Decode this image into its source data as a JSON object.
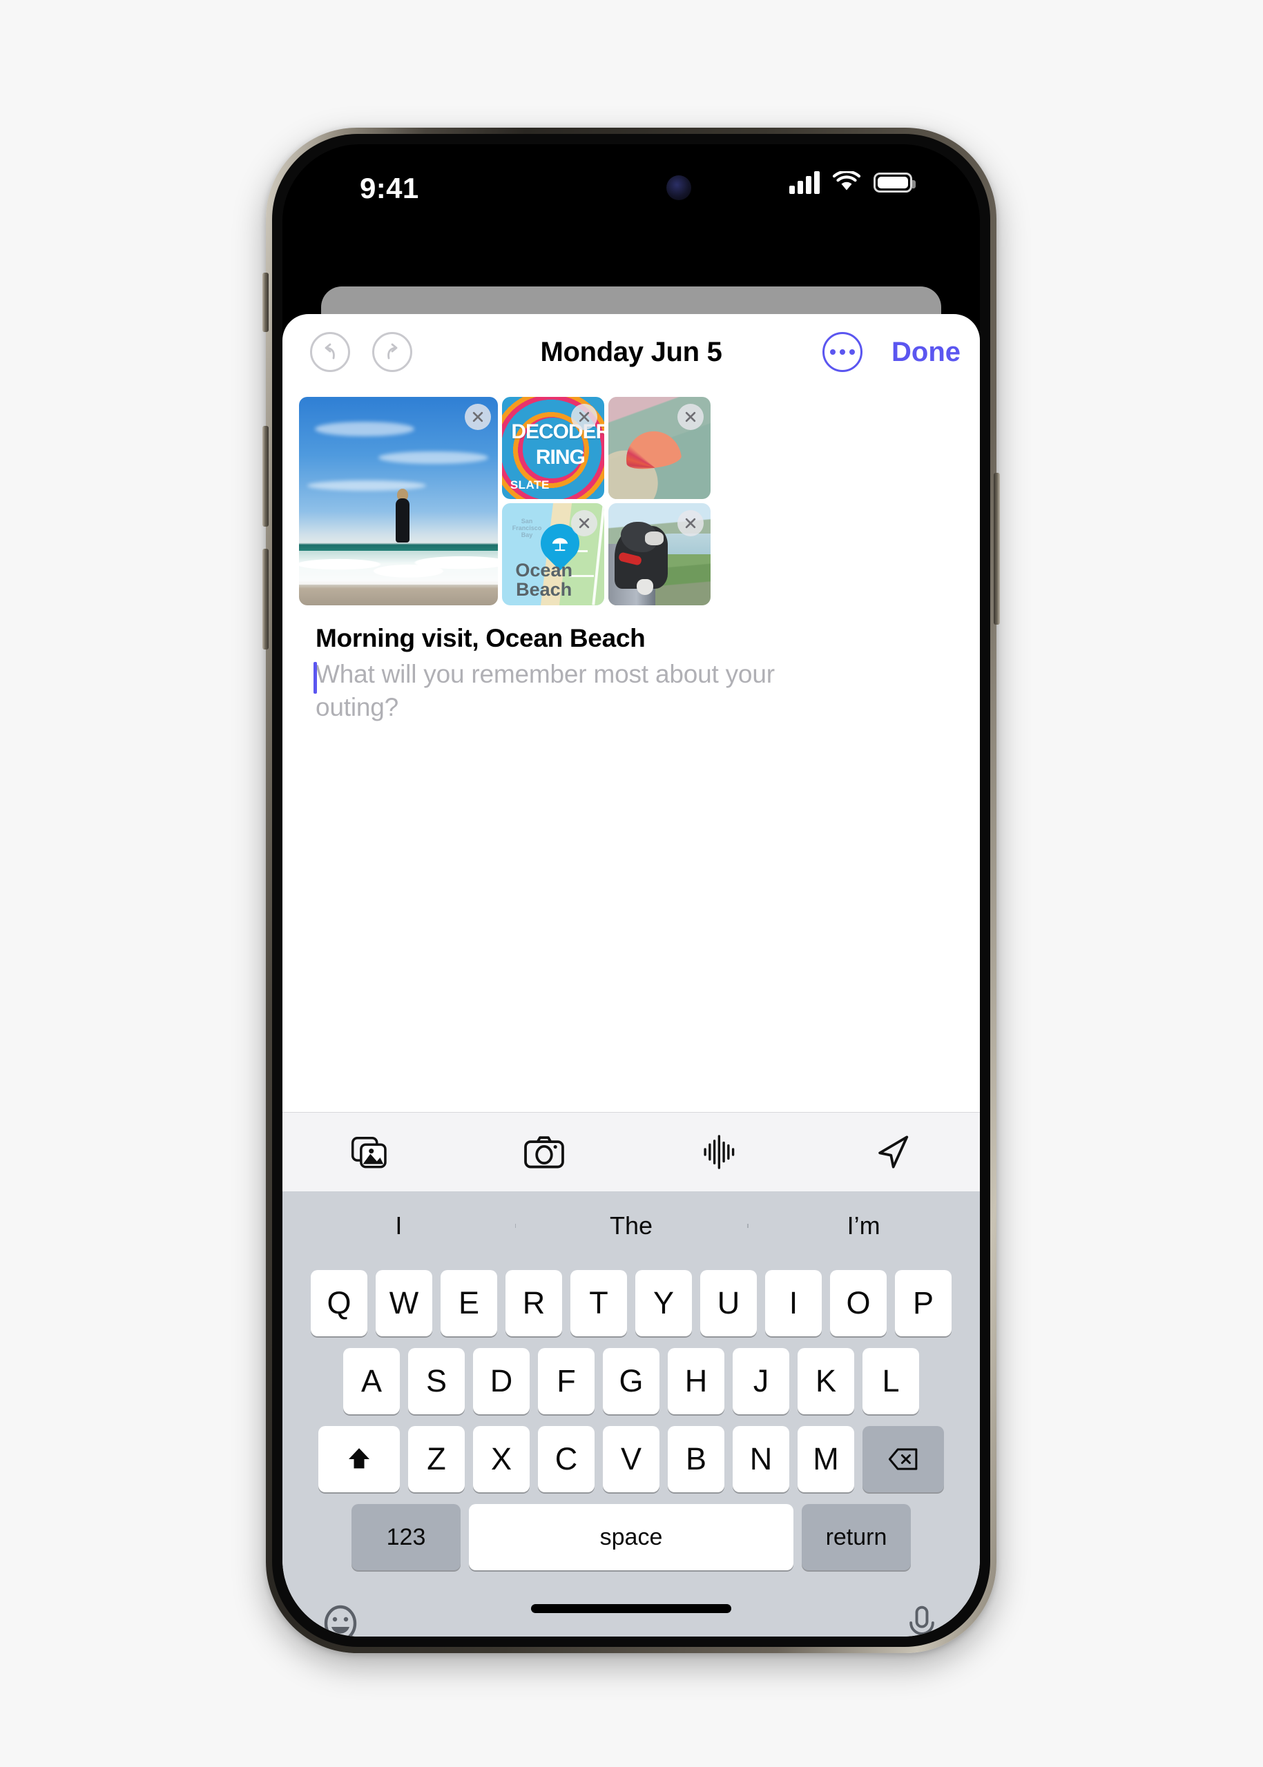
{
  "status_bar": {
    "time": "9:41",
    "cellular_icon": "signal-bars-icon",
    "wifi_icon": "wifi-icon",
    "battery_icon": "battery-icon"
  },
  "nav": {
    "undo_icon": "undo-icon",
    "redo_icon": "redo-icon",
    "title": "Monday Jun 5",
    "more_icon": "ellipsis-circle-icon",
    "done_label": "Done"
  },
  "media": {
    "remove_icon": "close-x-icon",
    "tiles": [
      {
        "name": "surfer-photo",
        "alt": "Woman in wetsuit walking out of the ocean at the beach"
      },
      {
        "name": "decoder-ring-podcast",
        "title_line1": "DECODER",
        "title_line2": "RING",
        "brand": "SLATE"
      },
      {
        "name": "seashell-photo",
        "alt": "Pink scallop shell resting on a green knit blanket in the sand"
      },
      {
        "name": "ocean-beach-map",
        "bay_label": "San\nFrancisco\nBay",
        "place_line1": "Ocean",
        "place_line2": "Beach",
        "pin_icon": "beach-umbrella-icon"
      },
      {
        "name": "dog-photo",
        "alt": "Black and white dog looking out of a car window above the coastline"
      }
    ]
  },
  "entry": {
    "title": "Morning visit, Ocean Beach",
    "placeholder": "What will you remember most about your outing?"
  },
  "attachment_toolbar": {
    "buttons": [
      {
        "name": "photo-library-button",
        "icon": "photos-stack-icon"
      },
      {
        "name": "camera-button",
        "icon": "camera-icon"
      },
      {
        "name": "audio-record-button",
        "icon": "waveform-icon"
      },
      {
        "name": "location-button",
        "icon": "location-arrow-icon"
      }
    ]
  },
  "keyboard": {
    "predictions": [
      "I",
      "The",
      "I’m"
    ],
    "row1": [
      "Q",
      "W",
      "E",
      "R",
      "T",
      "Y",
      "U",
      "I",
      "O",
      "P"
    ],
    "row2": [
      "A",
      "S",
      "D",
      "F",
      "G",
      "H",
      "J",
      "K",
      "L"
    ],
    "row3": [
      "Z",
      "X",
      "C",
      "V",
      "B",
      "N",
      "M"
    ],
    "shift_icon": "shift-arrow-icon",
    "backspace_icon": "backspace-delete-icon",
    "numeric_label": "123",
    "space_label": "space",
    "return_label": "return",
    "emoji_icon": "emoji-smiley-icon",
    "dictation_icon": "microphone-icon"
  },
  "colors": {
    "accent": "#5b56f0",
    "keyboard_bg": "#cdd1d7",
    "key_bg": "#ffffff",
    "func_key_bg": "#a9afb8",
    "toolbar_bg": "#f4f4f6",
    "placeholder_text": "#b0b0b5",
    "page_bg": "#f7f7f7"
  }
}
